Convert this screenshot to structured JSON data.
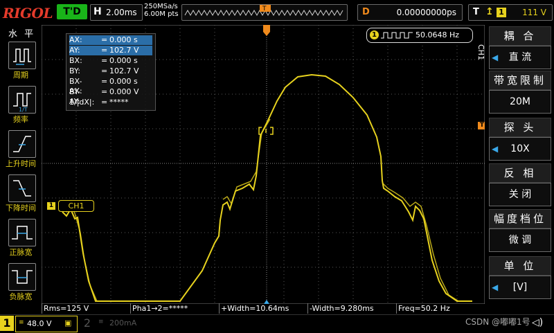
{
  "brand": "RIGOL",
  "trigger_status": "T'D",
  "timebase": {
    "key": "H",
    "value": "2.00ms"
  },
  "sampling": {
    "rate": "250MSa/s",
    "points": "6.00M pts"
  },
  "delay": {
    "key": "D",
    "value": "0.00000000ps"
  },
  "trigger": {
    "key": "T",
    "source": "1",
    "level": "111 V"
  },
  "left_menu": {
    "title": "水 平",
    "items": [
      {
        "label": "周期",
        "icon": "period-icon"
      },
      {
        "label": "频率",
        "icon": "frequency-icon"
      },
      {
        "label": "上升时间",
        "icon": "rise-time-icon"
      },
      {
        "label": "下降时间",
        "icon": "fall-time-icon"
      },
      {
        "label": "正脉宽",
        "icon": "positive-width-icon"
      },
      {
        "label": "负脉宽",
        "icon": "negative-width-icon"
      }
    ]
  },
  "cursor_measure": {
    "rows": [
      {
        "label": "AX:",
        "value": "0.000 s",
        "highlight": true
      },
      {
        "label": "AY:",
        "value": "102.7 V",
        "highlight": true
      },
      {
        "label": "BX:",
        "value": "0.000 s",
        "highlight": false
      },
      {
        "label": "BY:",
        "value": "102.7 V",
        "highlight": false
      },
      {
        "label": "BX-AX:",
        "value": "0.000 s",
        "highlight": false
      },
      {
        "label": "BY-AY:",
        "value": "0.000 V",
        "highlight": false
      },
      {
        "label": "1/|dX|:",
        "value": "*****",
        "highlight": false
      }
    ]
  },
  "freq_counter": {
    "channel": "1",
    "value": "50.0648 Hz"
  },
  "ch1_marker": "CH1",
  "ch1_ground_marker": "1",
  "trigger_marker": "T",
  "right_panel": {
    "channel": "CH1",
    "items": [
      {
        "title": "耦 合",
        "value": "直 流",
        "arrow": true
      },
      {
        "title": "带宽限制",
        "value": "20M",
        "arrow": false
      },
      {
        "title": "探 头",
        "value": "10X",
        "arrow": true
      },
      {
        "title": "反 相",
        "value": "关 闭",
        "arrow": false
      },
      {
        "title": "幅度档位",
        "value": "微 调",
        "arrow": false
      },
      {
        "title": "单 位",
        "value": "[V]",
        "arrow": true
      }
    ]
  },
  "bottom_measurements": [
    "Rms=125 V",
    "Pha⁦1→2=*****",
    "+Width=10.64ms",
    "-Width=9.280ms",
    "Freq=50.2 Hz"
  ],
  "channels": {
    "ch1": {
      "num": "1",
      "scale": "48.0 V"
    },
    "ch2": {
      "num": "2",
      "scale": "200mA"
    }
  },
  "watermark": "CSDN @嘟嘟1号",
  "colors": {
    "ch1": "#e7d21e",
    "trigger": "#f08a1c",
    "grid": "#5a5a5a",
    "accent": "#19b419"
  }
}
